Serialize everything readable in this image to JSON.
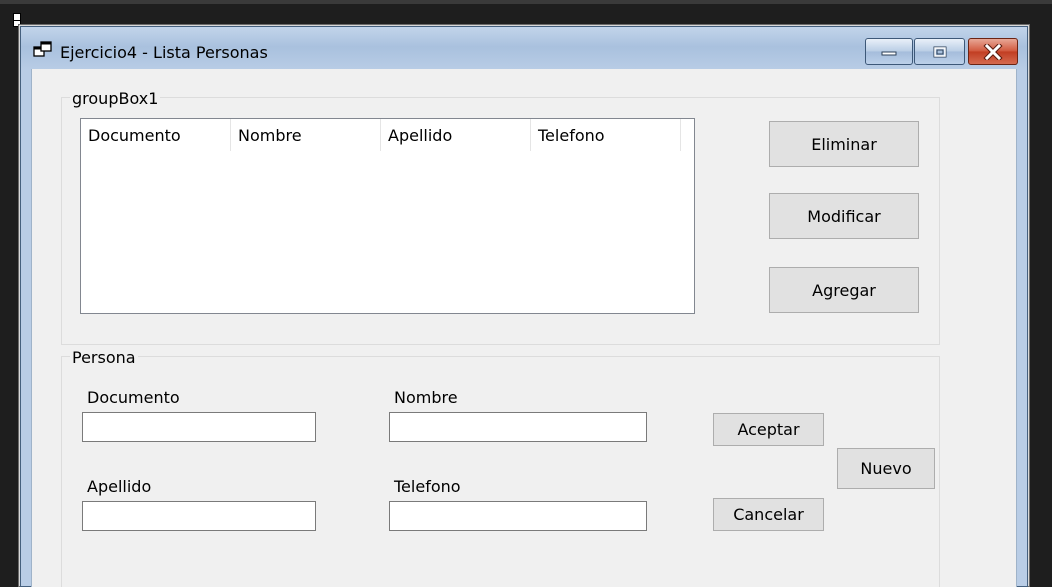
{
  "window": {
    "title": "Ejercicio4 - Lista Personas",
    "icon": "app-windows-icon",
    "controls": [
      "minimize-icon",
      "maximize-icon",
      "close-icon"
    ]
  },
  "colors": {
    "title_gradient_top": "#c2d4ea",
    "client_bg": "#f0f0f0",
    "close_button": "#c13d22",
    "button_bg": "#e1e1e1"
  },
  "group_list": {
    "caption": "groupBox1",
    "list_columns": [
      "Documento",
      "Nombre",
      "Apellido",
      "Telefono"
    ],
    "rows": [],
    "buttons": {
      "delete": "Eliminar",
      "modify": "Modificar",
      "add": "Agregar"
    }
  },
  "group_person": {
    "caption": "Persona",
    "fields": {
      "documento": {
        "label": "Documento",
        "value": ""
      },
      "nombre": {
        "label": "Nombre",
        "value": ""
      },
      "apellido": {
        "label": "Apellido",
        "value": ""
      },
      "telefono": {
        "label": "Telefono",
        "value": ""
      }
    },
    "buttons": {
      "accept": "Aceptar",
      "cancel": "Cancelar",
      "new": "Nuevo"
    }
  }
}
